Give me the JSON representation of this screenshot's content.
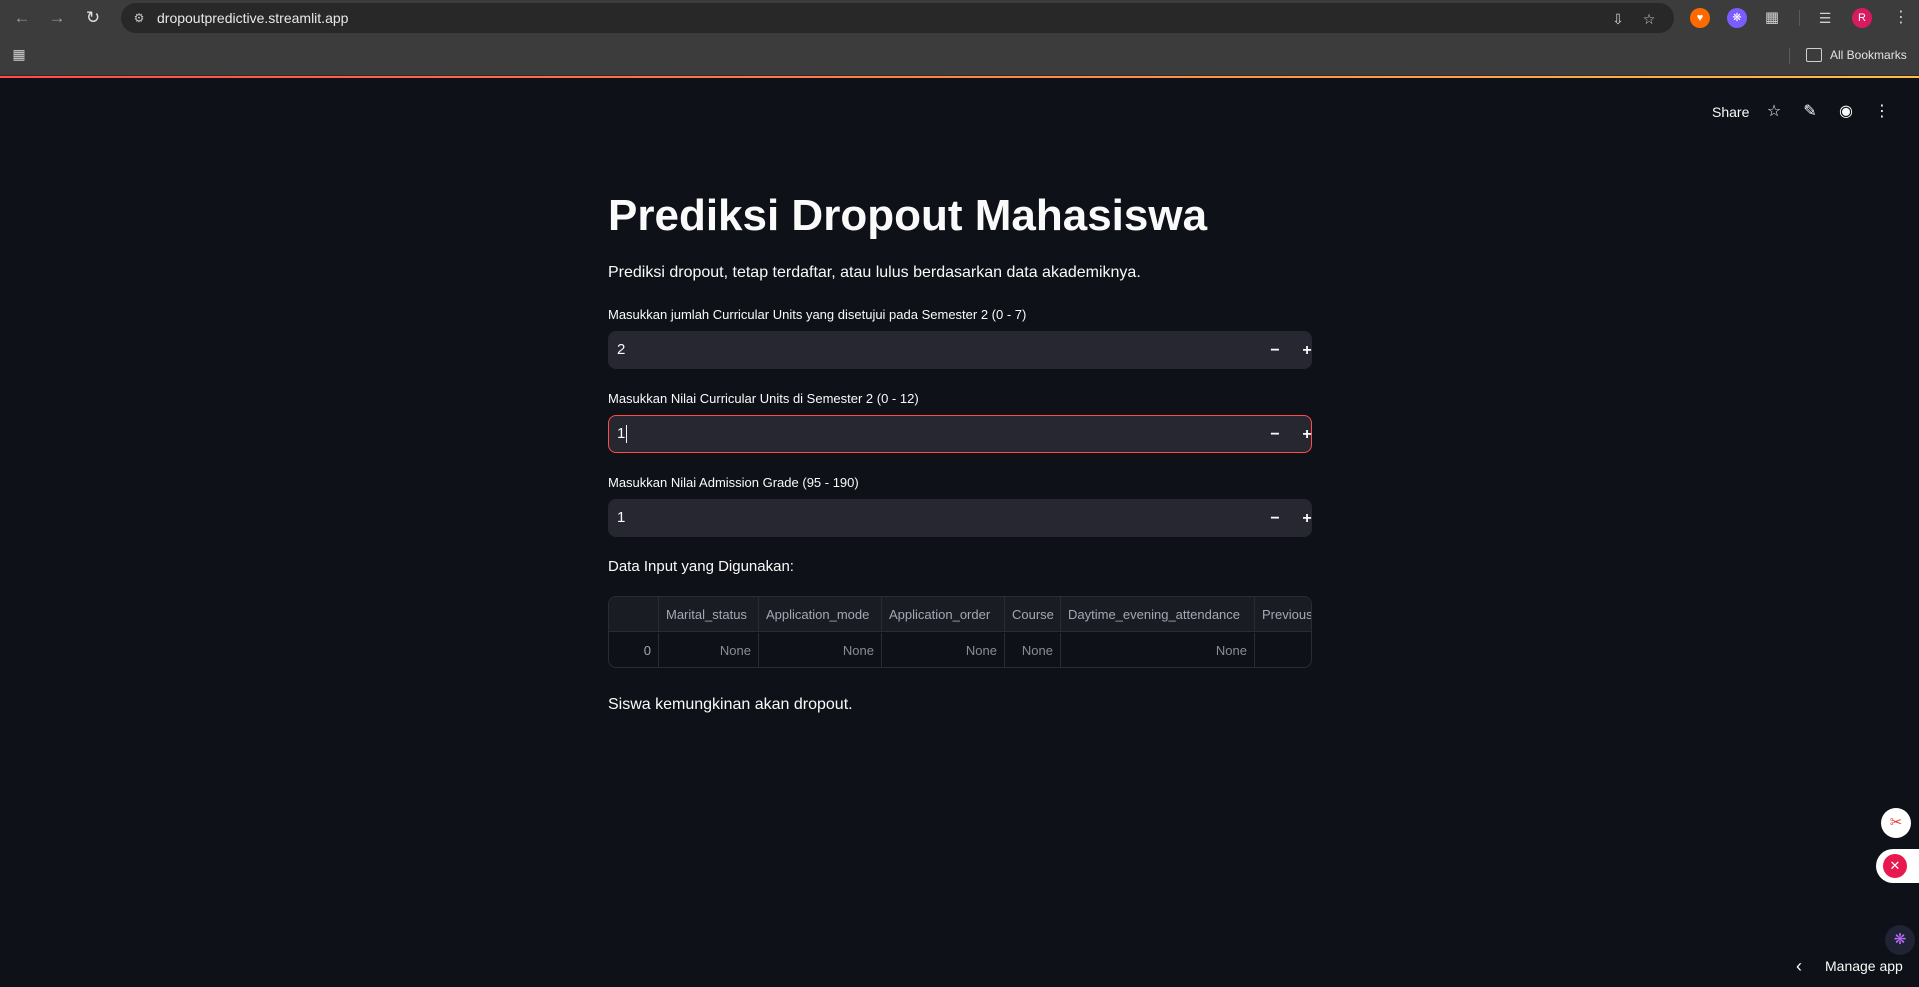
{
  "browser": {
    "url": "dropoutpredictive.streamlit.app",
    "bookmarks_label": "All Bookmarks",
    "profile_initial": "R"
  },
  "toolbar": {
    "share_label": "Share"
  },
  "page": {
    "title": "Prediksi Dropout Mahasiswa",
    "subtitle": "Prediksi dropout, tetap terdaftar, atau lulus berdasarkan data akademiknya."
  },
  "inputs": [
    {
      "label": "Masukkan jumlah Curricular Units yang disetujui pada Semester 2 (0 - 7)",
      "value": "2"
    },
    {
      "label": "Masukkan Nilai Curricular Units di Semester 2 (0 - 12)",
      "value": "1"
    },
    {
      "label": "Masukkan Nilai Admission Grade (95 - 190)",
      "value": "1"
    }
  ],
  "table": {
    "heading": "Data Input yang Digunakan:",
    "columns": [
      "",
      "Marital_status",
      "Application_mode",
      "Application_order",
      "Course",
      "Daytime_evening_attendance",
      "Previous"
    ],
    "rows": [
      [
        "0",
        "None",
        "None",
        "None",
        "None",
        "None",
        ""
      ]
    ]
  },
  "result": "Siswa kemungkinan akan dropout.",
  "footer": {
    "manage_app": "Manage app"
  },
  "colors": {
    "background": "#0e1117",
    "input_bg": "#262730",
    "accent": "#ff4b4b",
    "text": "#fafafa"
  }
}
